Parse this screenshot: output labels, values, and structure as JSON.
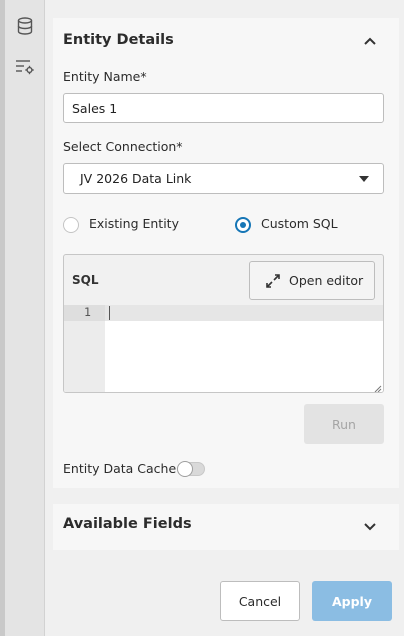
{
  "sidebar": {
    "icons": [
      {
        "name": "database-icon"
      },
      {
        "name": "settings-list-icon"
      }
    ]
  },
  "entity_details": {
    "title": "Entity Details",
    "collapse_icon": "chevron-up-icon",
    "entity_name_label": "Entity Name*",
    "entity_name_value": "Sales 1",
    "connection_label": "Select Connection*",
    "connection_value": "JV 2026 Data Link",
    "radio_existing_label": "Existing Entity",
    "radio_custom_label": "Custom SQL",
    "selected_source": "Custom SQL",
    "sql_label": "SQL",
    "open_editor_label": "Open editor",
    "line_number": "1",
    "sql_text": "",
    "run_label": "Run",
    "cache_label": "Entity Data Cache",
    "cache_enabled": false
  },
  "available_fields": {
    "title": "Available Fields",
    "expand_icon": "chevron-down-icon"
  },
  "footer": {
    "cancel_label": "Cancel",
    "apply_label": "Apply"
  },
  "colors": {
    "accent": "#1676b6",
    "apply_button": "#8bbde3",
    "disabled_text": "#a5a5a5"
  }
}
